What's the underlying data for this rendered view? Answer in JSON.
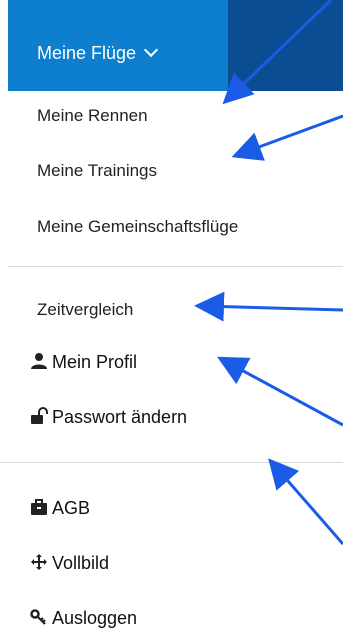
{
  "menu": {
    "title": "Meine Flüge",
    "items": [
      {
        "label": "Meine Rennen"
      },
      {
        "label": "Meine Trainings"
      },
      {
        "label": "Meine Gemeinschaftsflüge"
      },
      {
        "label": "Zeitvergleich"
      }
    ]
  },
  "profile_menu": {
    "items": [
      {
        "label": "Mein Profil",
        "icon": "user-icon"
      },
      {
        "label": "Passwort ändern",
        "icon": "unlock-icon"
      },
      {
        "label": "AGB",
        "icon": "briefcase-icon"
      },
      {
        "label": "Vollbild",
        "icon": "move-arrows-icon"
      },
      {
        "label": "Ausloggen",
        "icon": "key-icon"
      }
    ]
  },
  "colors": {
    "header_blue": "#0e7ecf",
    "header_dark_blue": "#0a4d92",
    "annotation_arrow": "#1a5ce6"
  }
}
